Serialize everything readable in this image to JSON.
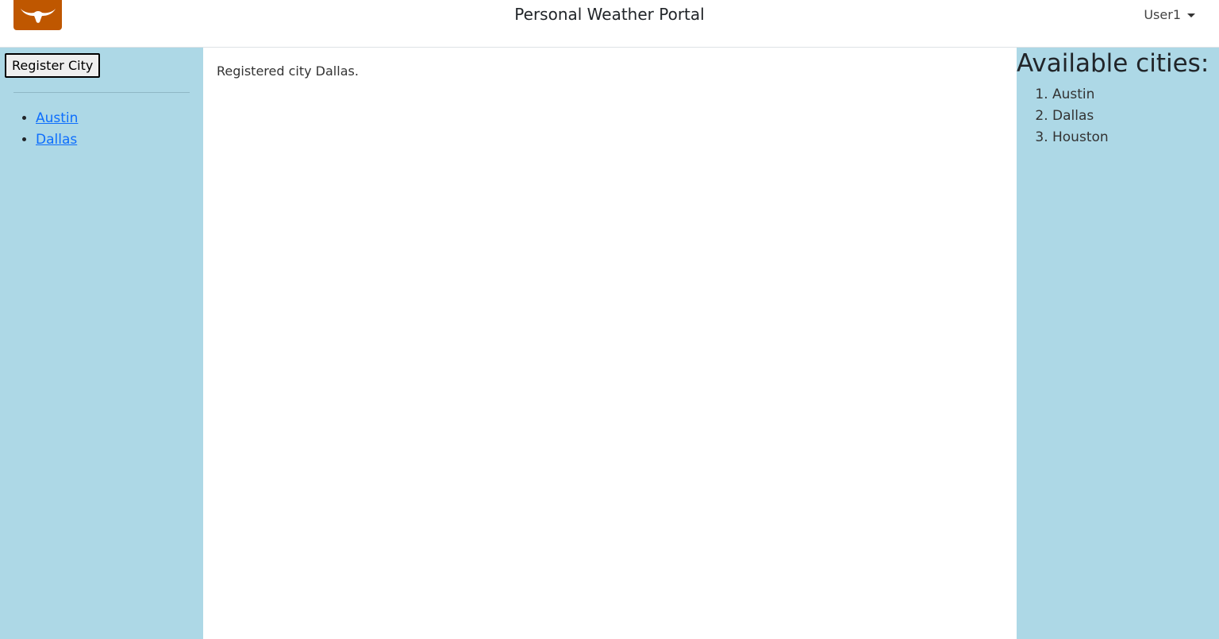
{
  "brand_color": "#bf5700",
  "panel_color": "#add8e6",
  "header": {
    "logo_icon": "longhorn-icon",
    "title": "Personal Weather Portal",
    "user": "User1"
  },
  "sidebar": {
    "register_label": "Register City",
    "cities": [
      "Austin",
      "Dallas"
    ]
  },
  "main": {
    "message": "Registered city Dallas."
  },
  "right": {
    "title": "Available cities:",
    "cities": [
      "Austin",
      "Dallas",
      "Houston"
    ]
  }
}
